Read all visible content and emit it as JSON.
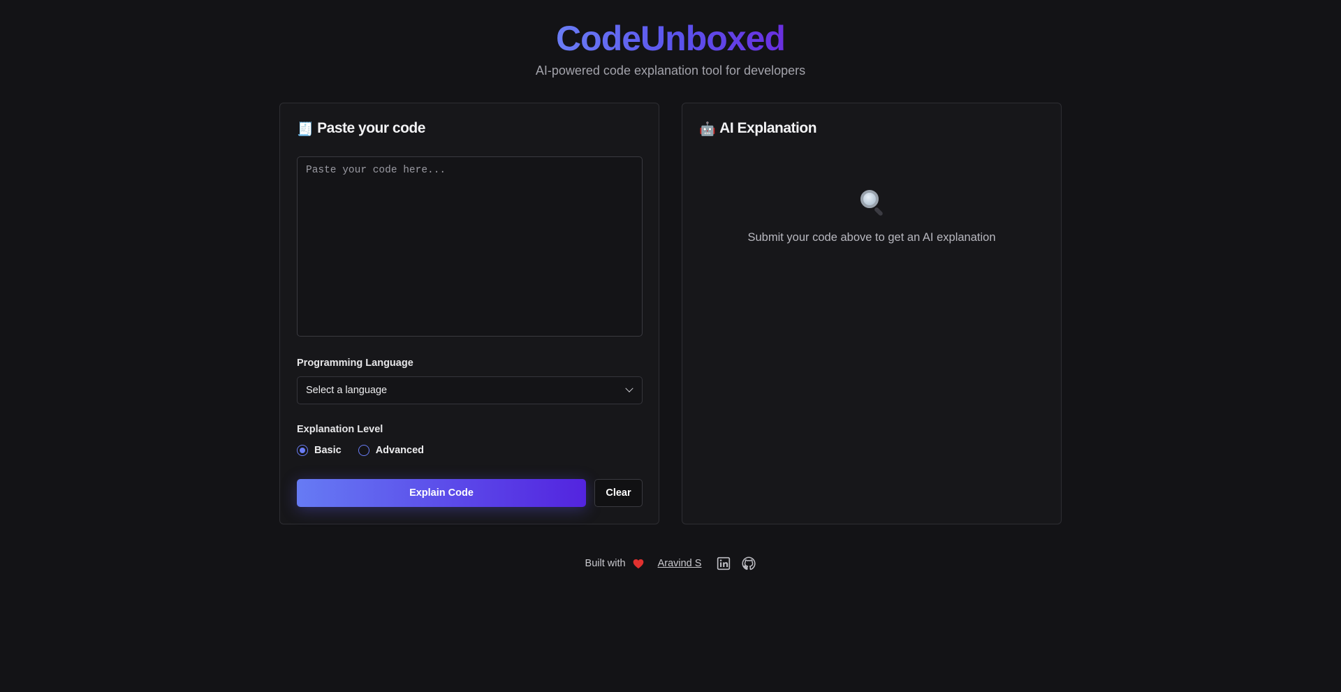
{
  "header": {
    "title": "CodeUnboxed",
    "subtitle": "AI-powered code explanation tool for developers"
  },
  "input_panel": {
    "icon": "receipt-emoji",
    "icon_glyph": "🧾",
    "title": "Paste your code",
    "code_placeholder": "Paste your code here...",
    "code_value": "",
    "language_label": "Programming Language",
    "language_selected": "Select a language",
    "level_label": "Explanation Level",
    "levels": [
      {
        "label": "Basic",
        "checked": true
      },
      {
        "label": "Advanced",
        "checked": false
      }
    ],
    "explain_button": "Explain Code",
    "clear_button": "Clear"
  },
  "output_panel": {
    "icon": "robot-emoji",
    "icon_glyph": "🤖",
    "title": "AI Explanation",
    "empty_icon": "magnifier-icon",
    "empty_text": "Submit your code above to get an AI explanation"
  },
  "footer": {
    "built_with": "Built with",
    "heart_icon": "heart-icon",
    "author": "Aravind S",
    "links": [
      "linkedin-icon",
      "github-icon"
    ]
  },
  "colors": {
    "background": "#131316",
    "panel": "#17171a",
    "accent_start": "#667bf4",
    "accent_end": "#5324df",
    "heart": "#e0312f"
  }
}
